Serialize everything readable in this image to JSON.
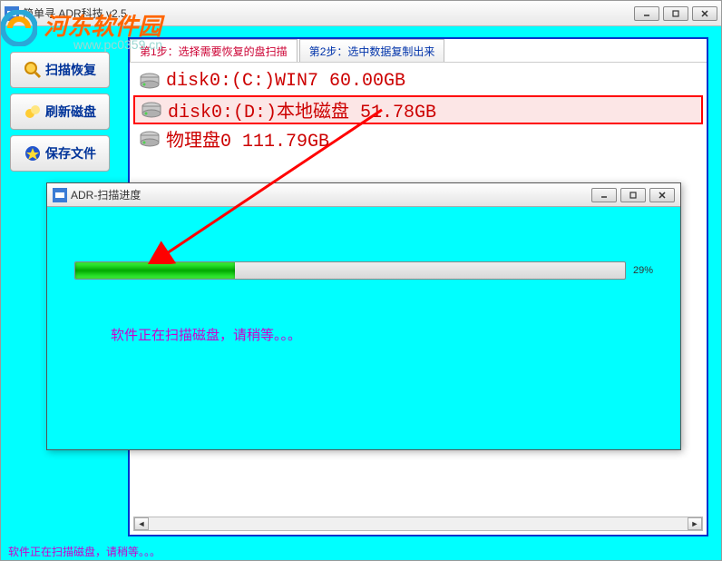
{
  "main_window": {
    "title": "简单寻    ADR科技 v2.5"
  },
  "watermark": {
    "text": "河东软件园",
    "url": "www.pc0359.cn"
  },
  "sidebar": {
    "items": [
      {
        "label": "扫描恢复"
      },
      {
        "label": "刷新磁盘"
      },
      {
        "label": "保存文件"
      }
    ]
  },
  "tabs": {
    "step1": "第1步：选择需要恢复的盘扫描",
    "step2": "第2步：选中数据复制出来"
  },
  "disks": [
    {
      "text": "disk0:(C:)WIN7 60.00GB",
      "highlight": false
    },
    {
      "text": "disk0:(D:)本地磁盘 51.78GB",
      "highlight": true
    },
    {
      "text": "物理盘0 111.79GB",
      "highlight": false
    }
  ],
  "dialog": {
    "title": "ADR-扫描进度",
    "progress_pct": 29,
    "progress_label": "29%",
    "message": "软件正在扫描磁盘，请稍等。。。"
  },
  "statusbar": {
    "text": "软件正在扫描磁盘，请稍等。。。"
  }
}
